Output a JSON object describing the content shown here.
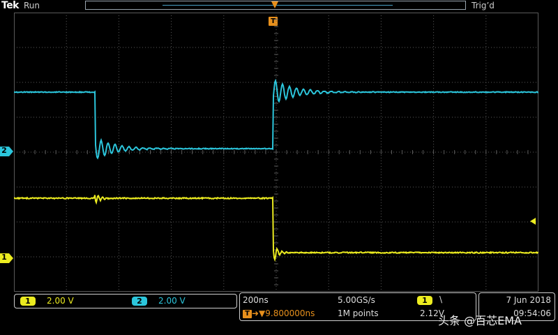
{
  "top_bar": {
    "brand": "Tek",
    "run_state": "Run",
    "trig_state": "Trig’d",
    "trigger_marker": "T"
  },
  "colors": {
    "ch1": "#ecec20",
    "ch2": "#2cc6dc",
    "trigger": "#e8901c",
    "grid": "#5a5a5a"
  },
  "channel_markers": {
    "ch1_label": "1",
    "ch2_label": "2"
  },
  "status": {
    "ch1": {
      "badge": "1",
      "scale": "2.00 V"
    },
    "ch2": {
      "badge": "2",
      "scale": "2.00 V"
    },
    "horizontal": {
      "time_div": "200ns",
      "sample_rate": "5.00GS/s",
      "trigger_icon": "T",
      "delay_arrow": "➜▼",
      "delay": "9.800000ns",
      "record_length": "1M points"
    },
    "trigger": {
      "source_badge": "1",
      "slope": "\\",
      "level": "2.12V"
    },
    "datetime": {
      "date": "7 Jun  2018",
      "time": "09:54:06"
    }
  },
  "watermark": "头条 @百芯EMA"
}
